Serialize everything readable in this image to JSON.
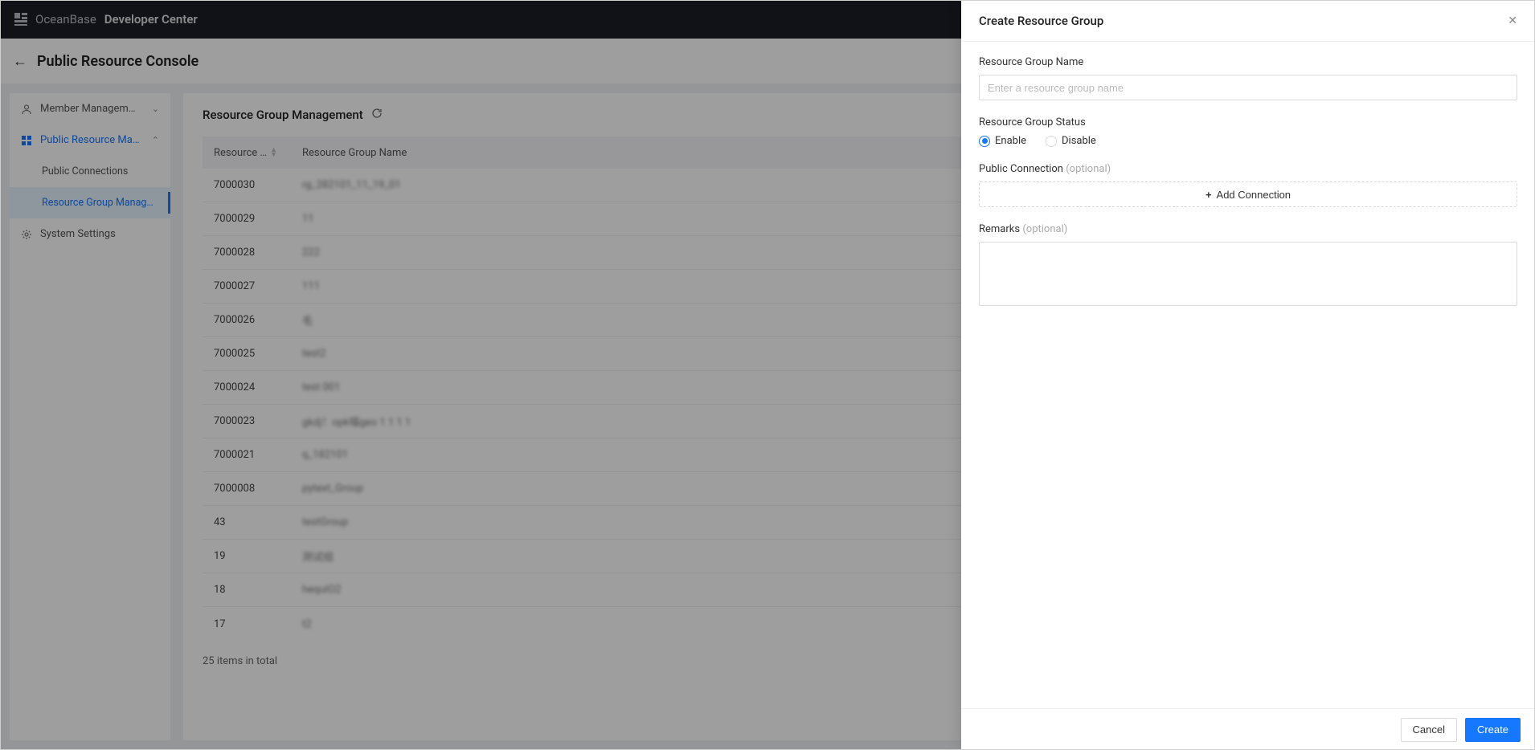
{
  "header": {
    "brand_main": "OceanBase",
    "brand_sub": "Developer Center"
  },
  "page": {
    "title": "Public Resource Console"
  },
  "sidebar": {
    "items": [
      {
        "label": "Member Managem…",
        "icon": "user",
        "expanded": false,
        "level": 1
      },
      {
        "label": "Public Resource Ma…",
        "icon": "grid",
        "expanded": true,
        "level": 1,
        "selected": true
      },
      {
        "label": "Public Connections",
        "level": 2
      },
      {
        "label": "Resource Group Manag…",
        "level": 2,
        "active": true
      },
      {
        "label": "System Settings",
        "icon": "gear",
        "level": 1
      }
    ]
  },
  "main": {
    "title": "Resource Group Management",
    "columns": {
      "id": "Resource …",
      "name": "Resource Group Name"
    },
    "rows": [
      {
        "id": "7000030",
        "name": "rg_282101_11_19_01"
      },
      {
        "id": "7000029",
        "name": "11"
      },
      {
        "id": "7000028",
        "name": "222"
      },
      {
        "id": "7000027",
        "name": "111"
      },
      {
        "id": "7000026",
        "name": "毛"
      },
      {
        "id": "7000025",
        "name": "test2"
      },
      {
        "id": "7000024",
        "name": "test  001"
      },
      {
        "id": "7000023",
        "name": "gkdj！opk喵geo 1 1 1 1"
      },
      {
        "id": "7000021",
        "name": "q_182101"
      },
      {
        "id": "7000008",
        "name": "pytext_Group"
      },
      {
        "id": "43",
        "name": "testGroup"
      },
      {
        "id": "19",
        "name": "测试组"
      },
      {
        "id": "18",
        "name": "hequIO2"
      },
      {
        "id": "17",
        "name": "t2"
      }
    ],
    "footer": "25 items in total"
  },
  "drawer": {
    "title": "Create Resource Group",
    "fields": {
      "name_label": "Resource Group Name",
      "name_placeholder": "Enter a resource group name",
      "status_label": "Resource Group Status",
      "status_enable": "Enable",
      "status_disable": "Disable",
      "conn_label": "Public Connection",
      "conn_optional": "(optional)",
      "conn_add": "Add Connection",
      "remarks_label": "Remarks",
      "remarks_optional": "(optional)"
    },
    "buttons": {
      "cancel": "Cancel",
      "create": "Create"
    }
  }
}
